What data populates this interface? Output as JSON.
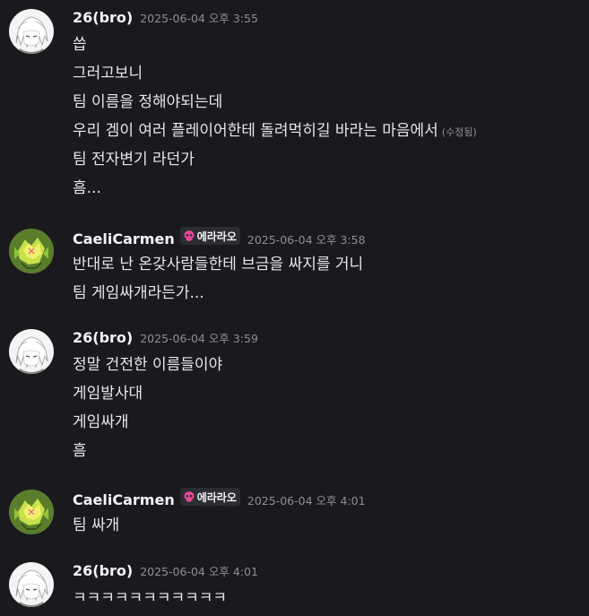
{
  "messages": [
    {
      "author": "26(bro)",
      "avatar": "white-haired-anime-avatar",
      "timestamp": "2025-06-04 오후 3:55",
      "tag": null,
      "lines": [
        {
          "text": "씁"
        },
        {
          "text": "그러고보니"
        },
        {
          "text": "팀 이름을 정해야되는데"
        },
        {
          "text": "우리 겜이 여러 플레이어한테 돌려먹히길 바라는 마음에서",
          "edited": "(수정됨)"
        },
        {
          "text": "팀 전자변기 라던가"
        },
        {
          "text": "흠..."
        }
      ]
    },
    {
      "author": "CaeliCarmen",
      "avatar": "green-yellow-sprite-avatar",
      "timestamp": "2025-06-04 오후 3:58",
      "tag": "에라라오",
      "lines": [
        {
          "text": "반대로 난 온갖사람들한테 브금을 싸지를 거니"
        },
        {
          "text": "팀 게임싸개라든가..."
        }
      ]
    },
    {
      "author": "26(bro)",
      "avatar": "white-haired-anime-avatar",
      "timestamp": "2025-06-04 오후 3:59",
      "tag": null,
      "lines": [
        {
          "text": "정말 건전한 이름들이야"
        },
        {
          "text": "게임발사대"
        },
        {
          "text": "게임싸개"
        },
        {
          "text": "흠"
        }
      ]
    },
    {
      "author": "CaeliCarmen",
      "avatar": "green-yellow-sprite-avatar",
      "timestamp": "2025-06-04 오후 4:01",
      "tag": "에라라오",
      "lines": [
        {
          "text": "팀 싸개"
        }
      ]
    },
    {
      "author": "26(bro)",
      "avatar": "white-haired-anime-avatar",
      "timestamp": "2025-06-04 오후 4:01",
      "tag": null,
      "lines": [
        {
          "text": "ㅋㅋㅋㅋㅋㅋㅋㅋㅋㅋㅋ"
        }
      ]
    }
  ],
  "colors": {
    "background": "#1a1a1e",
    "username": "#f2f3f5",
    "timestamp": "#8d8e95",
    "message_text": "#e6e7e9",
    "tag_background": "#2c2d32",
    "skull_pink": "#ec4899"
  }
}
